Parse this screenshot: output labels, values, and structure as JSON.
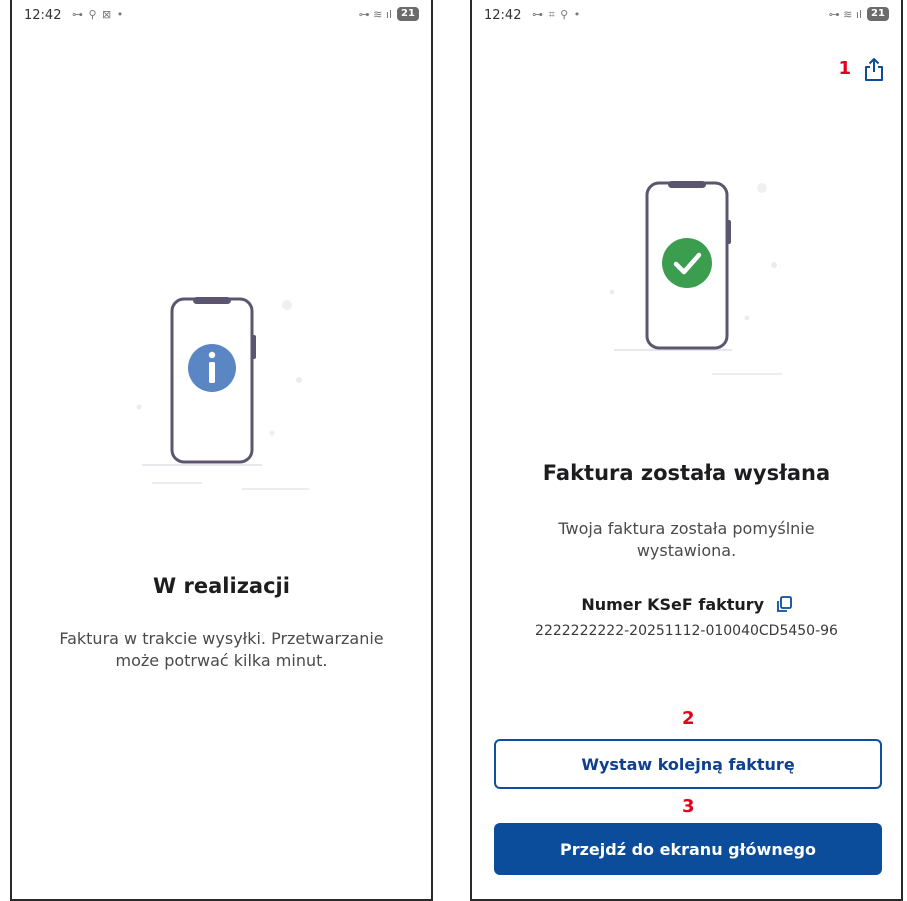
{
  "left_screen": {
    "status_time": "12:42",
    "status_battery": "21",
    "title": "W realizacji",
    "description_line1": "Faktura w trakcie wysyłki. Przetwarzanie",
    "description_line2": "może potrwać kilka minut.",
    "status_icon": "info-icon"
  },
  "right_screen": {
    "status_time": "12:42",
    "status_battery": "21",
    "title": "Faktura została wysłana",
    "description_line1": "Twoja faktura została pomyślnie",
    "description_line2": "wystawiona.",
    "ksef_label": "Numer KSeF faktury",
    "ksef_number": "2222222222-20251112-010040CD5450-96",
    "secondary_button": "Wystaw kolejną fakturę",
    "primary_button": "Przejdź do ekranu głównego",
    "status_icon": "success-check-icon"
  },
  "annotations": {
    "share": "1",
    "secondary": "2",
    "primary": "3"
  },
  "colors": {
    "primary": "#0b4c9b",
    "info": "#5a86c4",
    "success": "#3a9e4e",
    "annotation": "#e3001b"
  }
}
